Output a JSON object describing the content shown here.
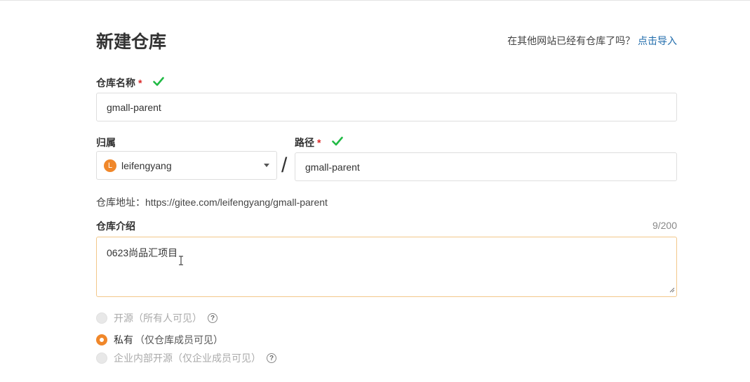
{
  "page": {
    "title": "新建仓库",
    "import_prompt": "在其他网站已经有仓库了吗？",
    "import_link": "点击导入"
  },
  "repo_name": {
    "label": "仓库名称",
    "required_mark": "*",
    "value": "gmall-parent"
  },
  "owner": {
    "label": "归属",
    "avatar_letter": "L",
    "value": "leifengyang"
  },
  "separator": "/",
  "path": {
    "label": "路径",
    "required_mark": "*",
    "value": "gmall-parent"
  },
  "repo_address": {
    "label": "仓库地址：",
    "url": "https://gitee.com/leifengyang/gmall-parent"
  },
  "description": {
    "label": "仓库介绍",
    "counter": "9/200",
    "value": "0623尚品汇项目"
  },
  "visibility": {
    "options": [
      {
        "name": "开源",
        "note": "（所有人可见）",
        "selected": false,
        "enabled": false,
        "help": true
      },
      {
        "name": "私有",
        "note": "（仅仓库成员可见）",
        "selected": true,
        "enabled": true,
        "help": false
      },
      {
        "name": "企业内部开源",
        "note": "（仅企业成员可见）",
        "selected": false,
        "enabled": false,
        "help": true
      }
    ],
    "help_glyph": "?"
  },
  "colors": {
    "accent": "#f0872a",
    "link": "#1f6bab",
    "check": "#21ba45",
    "required": "#db2828",
    "textarea_focus_border": "#f2c78a"
  }
}
